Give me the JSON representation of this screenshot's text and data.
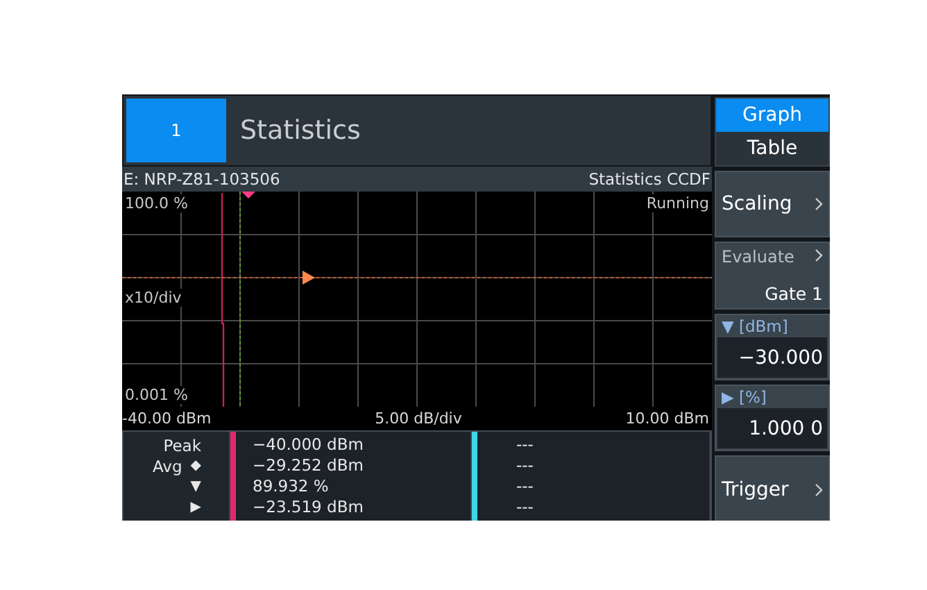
{
  "channel_tile": {
    "label": "1",
    "selected": true
  },
  "title": "Statistics",
  "view_toggle": [
    {
      "label": "Graph",
      "selected": true
    },
    {
      "label": "Table",
      "selected": false
    }
  ],
  "info_bar": {
    "sensor": "E: NRP-Z81-103506",
    "mode": "Statistics CCDF"
  },
  "plot": {
    "top_label": "100.0 %",
    "status": "Running",
    "scale_label": "x10/div",
    "bottom_label": "0.001 %"
  },
  "x_axis": {
    "start": "-40.00 dBm",
    "division": "5.00 dB/div",
    "stop": "10.00 dBm"
  },
  "readout_columns": [
    {
      "color": "#e0286e"
    },
    {
      "color": "#3dd5e8"
    }
  ],
  "readouts": [
    {
      "label": "Peak",
      "values": [
        "−40.000 dBm",
        "---"
      ]
    },
    {
      "label": "Avg",
      "symbol": "◆",
      "values": [
        "−29.252 dBm",
        "---"
      ]
    },
    {
      "symbol": "▼",
      "values": [
        "89.932 %",
        "---"
      ]
    },
    {
      "symbol": "▶",
      "values": [
        "−23.519 dBm",
        "---"
      ]
    }
  ],
  "softkeys": [
    {
      "kind": "menu",
      "label": "Scaling"
    },
    {
      "kind": "submenu",
      "label": "Evaluate",
      "value": "Gate 1"
    },
    {
      "kind": "field",
      "header": "▼ [dBm]",
      "value": "−30.000"
    },
    {
      "kind": "field",
      "header": "▶ [%]",
      "value": "1.000 0"
    },
    {
      "kind": "menu",
      "label": "Trigger"
    }
  ]
}
